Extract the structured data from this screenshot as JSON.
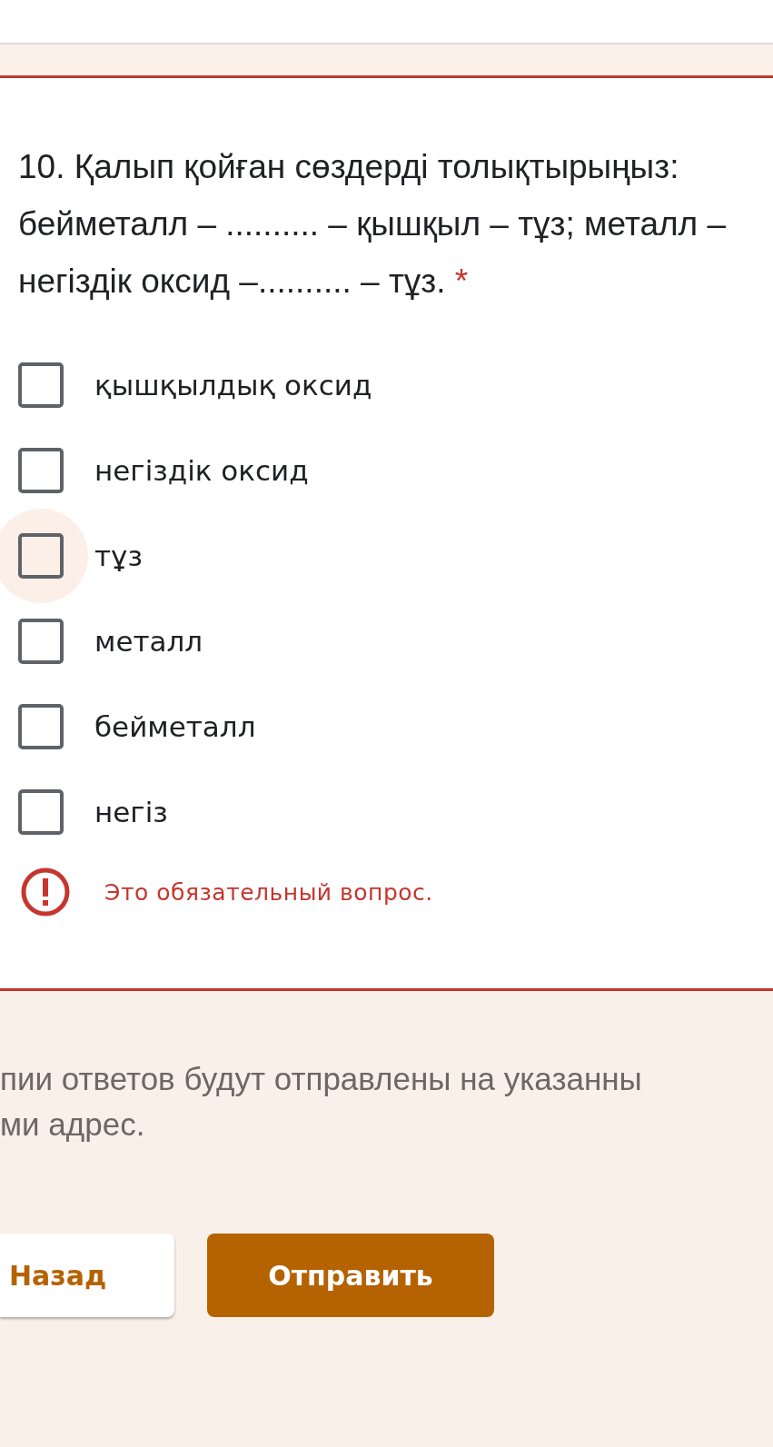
{
  "question": {
    "text": "10. Қалып қойған сөздерді толықтырыңыз: бейметалл – .......... – қышқыл – тұз; металл – негіздік оксид –.......... – тұз.",
    "required_mark": "*"
  },
  "options": [
    {
      "label": "қышқылдық оксид",
      "checked": false,
      "focused": false
    },
    {
      "label": "негіздік оксид",
      "checked": false,
      "focused": false
    },
    {
      "label": "тұз",
      "checked": false,
      "focused": true
    },
    {
      "label": "металл",
      "checked": false,
      "focused": false
    },
    {
      "label": "бейметалл",
      "checked": false,
      "focused": false
    },
    {
      "label": "негіз",
      "checked": false,
      "focused": false
    }
  ],
  "error": "Это обязательный вопрос.",
  "footer": {
    "note_lines": [
      "пии ответов будут отправлены на указанны",
      "ми адрес."
    ],
    "back_button": "Назад",
    "submit_button": "Отправить"
  }
}
